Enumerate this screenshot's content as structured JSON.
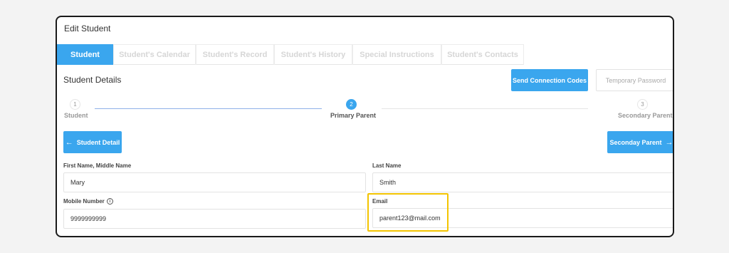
{
  "window": {
    "title": "Edit Student"
  },
  "tabs": [
    {
      "label": "Student Details",
      "active": true
    },
    {
      "label": "Student's Calendar",
      "active": false
    },
    {
      "label": "Student's Record",
      "active": false
    },
    {
      "label": "Student's History",
      "active": false
    },
    {
      "label": "Special Instructions",
      "active": false
    },
    {
      "label": "Student's Contacts",
      "active": false
    }
  ],
  "section": {
    "title": "Student Details"
  },
  "actions": {
    "send_codes": "Send Connection Codes",
    "temp_password": "Temporary Password"
  },
  "stepper": {
    "steps": [
      {
        "number": "1",
        "label": "Student"
      },
      {
        "number": "2",
        "label": "Primary Parent"
      },
      {
        "number": "3",
        "label": "Secondary Parent"
      }
    ],
    "current_step": 2
  },
  "nav": {
    "prev_label": "Student Detail",
    "next_label": "Seconday Parent"
  },
  "form": {
    "first_name": {
      "label": "First Name, Middle Name",
      "value": "Mary"
    },
    "last_name": {
      "label": "Last Name",
      "value": "Smith"
    },
    "mobile": {
      "label": "Mobile Number",
      "value": "9999999999"
    },
    "email": {
      "label": "Email",
      "value": "parent123@mail.com"
    }
  },
  "colors": {
    "accent": "#3aa6ee",
    "highlight": "#f3c400",
    "frame": "#1a1a1a"
  },
  "icons": {
    "prev": "arrow-left-icon",
    "next": "arrow-right-icon",
    "info": "info-circle-icon"
  }
}
